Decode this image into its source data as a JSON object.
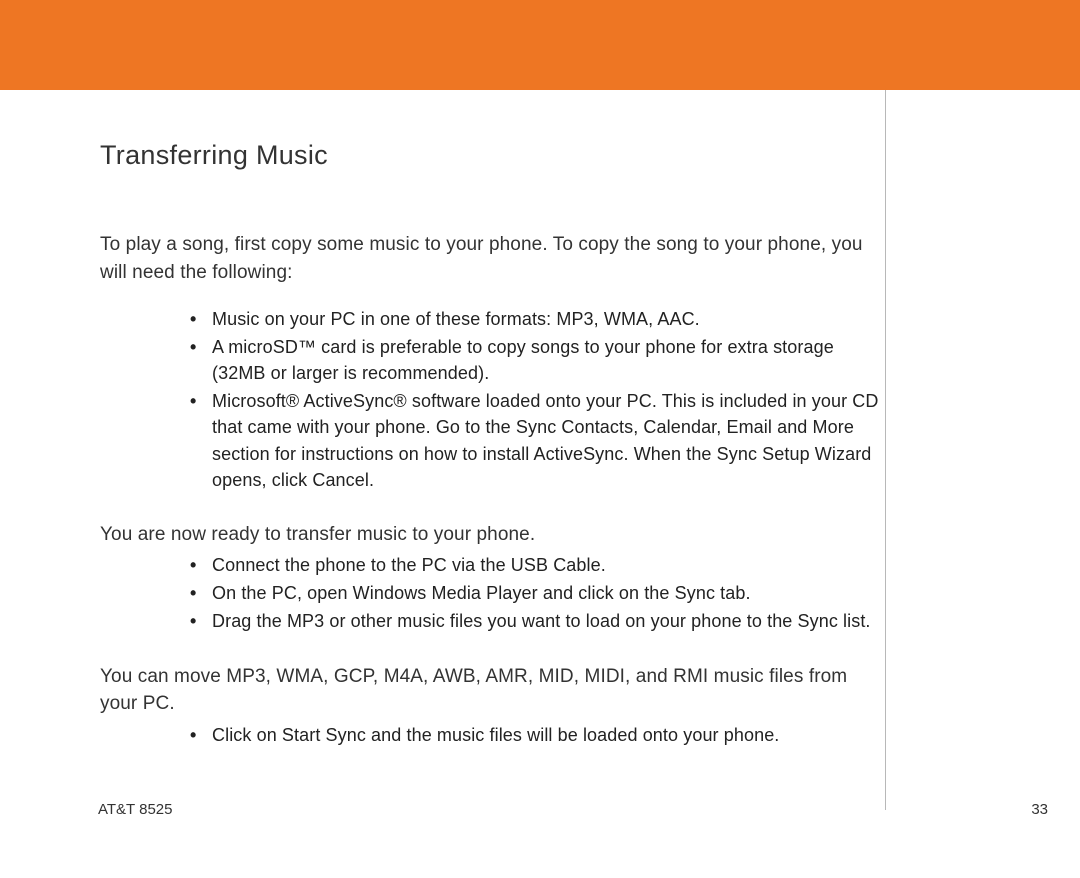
{
  "header": {
    "accent_color": "#ee7623"
  },
  "page": {
    "title": "Transferring Music",
    "intro": "To play a song, first copy some music to your phone.  To copy the song to your phone, you will need the following:"
  },
  "list1": {
    "items": {
      "0": "Music on your PC in one of these formats:  MP3, WMA, AAC.",
      "1": "A microSD™ card is preferable to copy songs to your phone for extra storage (32MB or larger is recommended).",
      "2": "Microsoft® ActiveSync® software loaded onto your PC. This is included in your CD that came with your phone.  Go to the Sync Contacts, Calendar, Email and More section for instructions on how to install ActiveSync.  When the Sync Setup Wizard opens, click Cancel."
    }
  },
  "mid": {
    "text": "You are now ready to transfer music to your phone."
  },
  "list2": {
    "items": {
      "0": "Connect the phone to the PC via the USB Cable.",
      "1": "On the PC, open Windows Media Player and click on the Sync tab.",
      "2": "Drag the MP3 or other music files you want to load on your phone to the Sync list."
    }
  },
  "last": {
    "text": "You can move MP3, WMA, GCP, M4A, AWB, AMR, MID, MIDI, and RMI music files from your PC."
  },
  "list3": {
    "items": {
      "0": "Click on Start Sync and the music files will be loaded onto your phone."
    }
  },
  "footer": {
    "left": "AT&T 8525",
    "right": "33"
  }
}
